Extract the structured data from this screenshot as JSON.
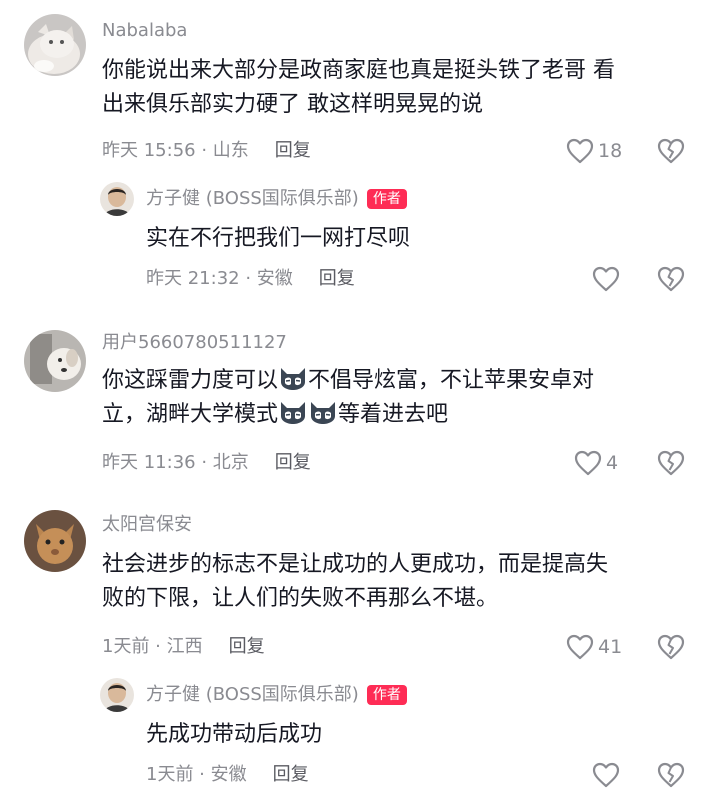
{
  "colors": {
    "author_badge": "#fe2c55",
    "secondary_text": "#8a8b91",
    "primary_text": "#161823"
  },
  "comments": [
    {
      "username": "Nabalaba",
      "text_lines": [
        "你能说出来大部分是政商家庭也真是挺头铁了老哥 看",
        "出来俱乐部实力硬了 敢这样明晃晃的说"
      ],
      "meta": "昨天 15:56 · 山东",
      "reply_label": "回复",
      "likes": "18",
      "avatar": "cat-avatar",
      "replies": [
        {
          "username": "方子健 (BOSS国际俱乐部)",
          "badge": "作者",
          "text": "实在不行把我们一网打尽呗",
          "meta": "昨天 21:32 · 安徽",
          "reply_label": "回复"
        }
      ]
    },
    {
      "username": "用户5660780511127",
      "text_line1_a": "你这踩雷力度可以",
      "text_line1_b": "不倡导炫富，不让苹果安卓对",
      "text_line2_a": "立，湖畔大学模式",
      "text_line2_b": "等着进去吧",
      "emoji": "wolf-grin-emoji",
      "meta": "昨天 11:36 · 北京",
      "reply_label": "回复",
      "likes": "4",
      "avatar": "dog-avatar"
    },
    {
      "username": "太阳宫保安",
      "text_lines": [
        "社会进步的标志不是让成功的人更成功，而是提高失",
        "败的下限，让人们的失败不再那么不堪。"
      ],
      "meta": "1天前 · 江西",
      "reply_label": "回复",
      "likes": "41",
      "avatar": "cat-orange-avatar",
      "replies": [
        {
          "username": "方子健 (BOSS国际俱乐部)",
          "badge": "作者",
          "text": "先成功带动后成功",
          "meta": "1天前 · 安徽",
          "reply_label": "回复"
        }
      ]
    }
  ]
}
